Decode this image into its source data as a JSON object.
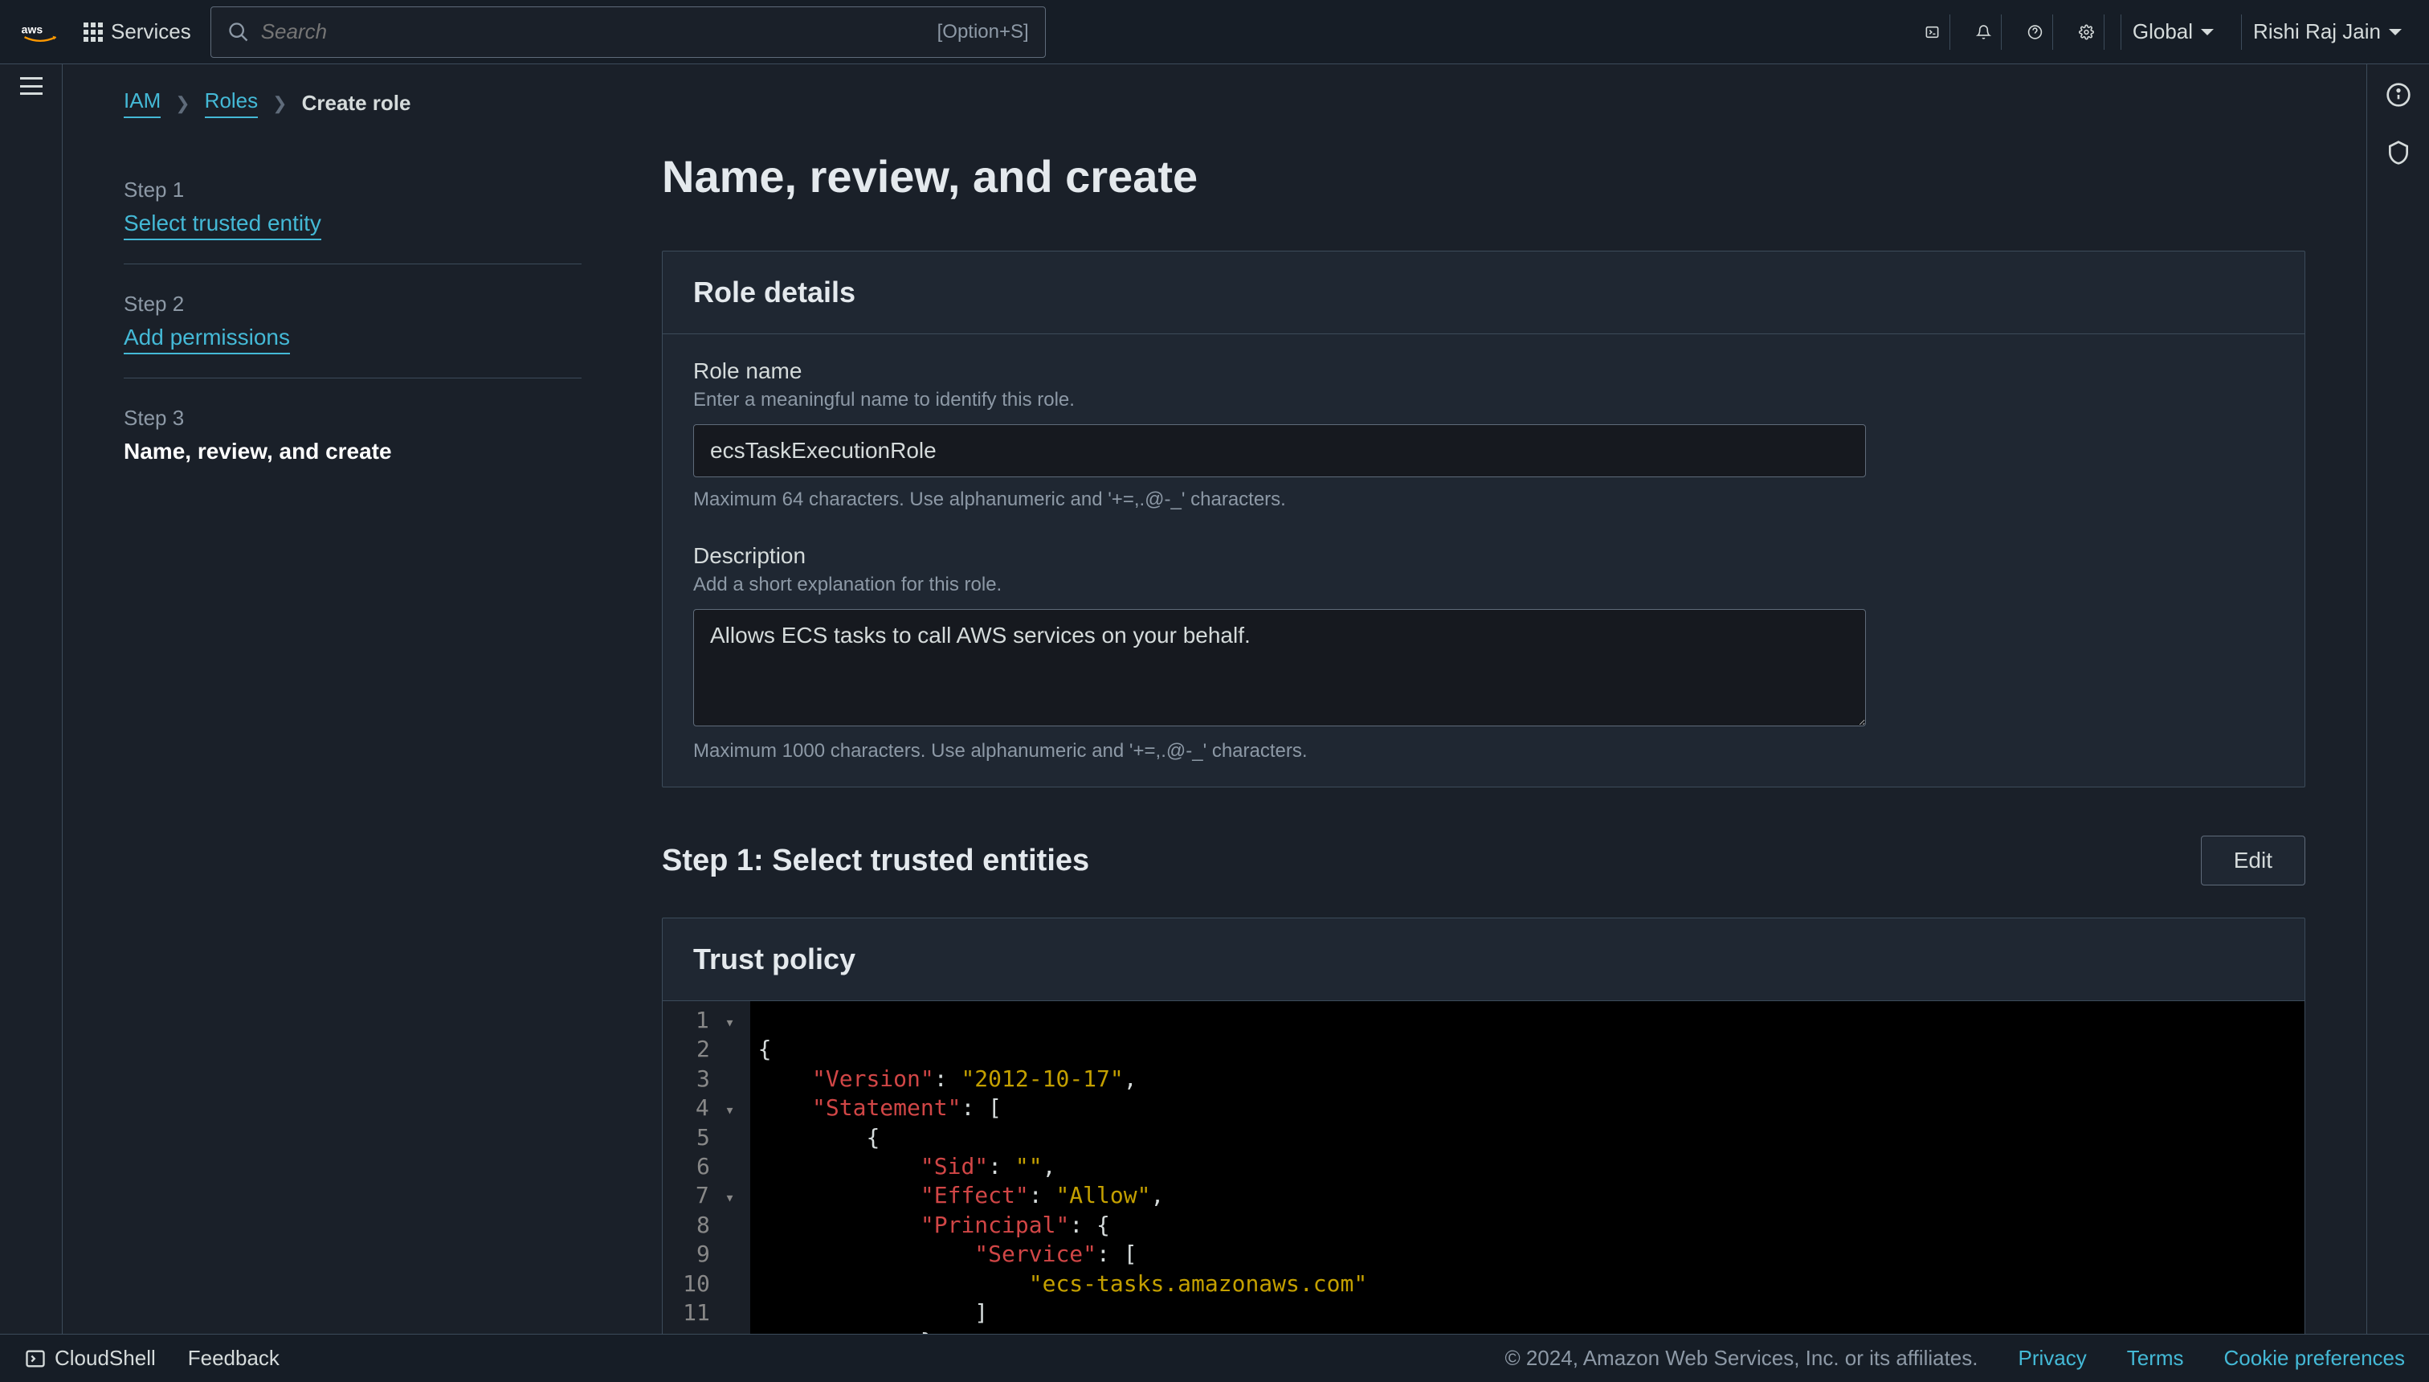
{
  "topnav": {
    "services_label": "Services",
    "search_placeholder": "Search",
    "search_shortcut": "[Option+S]",
    "region": "Global",
    "user": "Rishi Raj Jain"
  },
  "breadcrumbs": {
    "items": [
      "IAM",
      "Roles",
      "Create role"
    ]
  },
  "steps": [
    {
      "label": "Step 1",
      "title": "Select trusted entity",
      "link": true
    },
    {
      "label": "Step 2",
      "title": "Add permissions",
      "link": true
    },
    {
      "label": "Step 3",
      "title": "Name, review, and create",
      "link": false
    }
  ],
  "page_title": "Name, review, and create",
  "role_details": {
    "panel_title": "Role details",
    "role_name_label": "Role name",
    "role_name_hint": "Enter a meaningful name to identify this role.",
    "role_name_value": "ecsTaskExecutionRole",
    "role_name_footnote": "Maximum 64 characters. Use alphanumeric and '+=,.@-_' characters.",
    "description_label": "Description",
    "description_hint": "Add a short explanation for this role.",
    "description_value": "Allows ECS tasks to call AWS services on your behalf.",
    "description_footnote": "Maximum 1000 characters. Use alphanumeric and '+=,.@-_' characters."
  },
  "step1_section": {
    "title": "Step 1: Select trusted entities",
    "edit_label": "Edit"
  },
  "trust_policy": {
    "panel_title": "Trust policy"
  },
  "footer": {
    "cloudshell": "CloudShell",
    "feedback": "Feedback",
    "copyright": "© 2024, Amazon Web Services, Inc. or its affiliates.",
    "privacy": "Privacy",
    "terms": "Terms",
    "cookies": "Cookie preferences"
  }
}
